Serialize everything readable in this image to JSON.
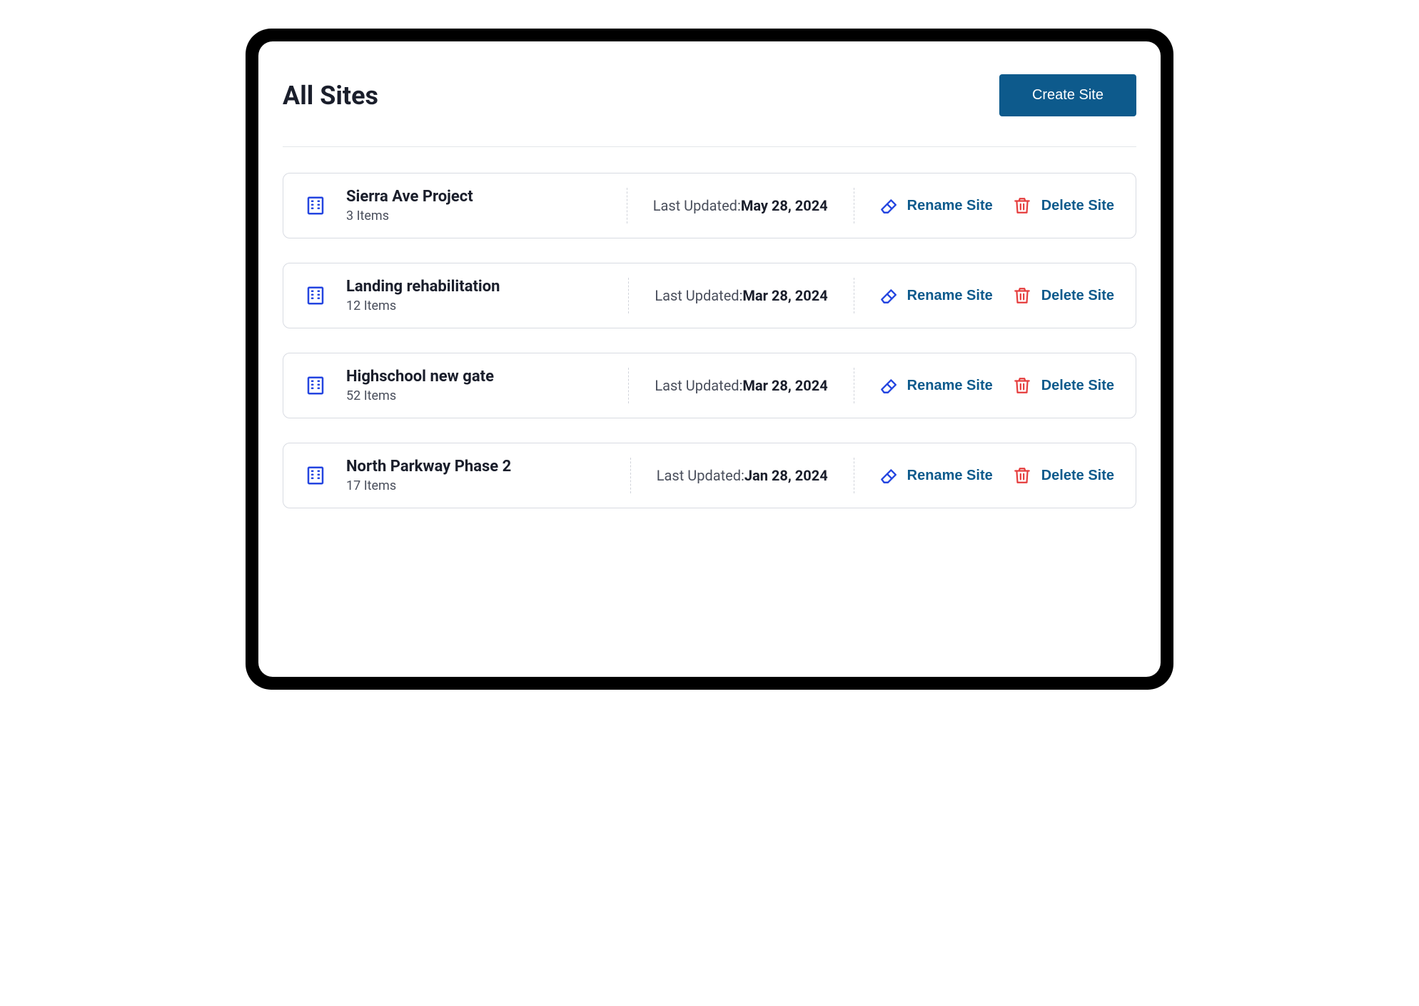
{
  "header": {
    "title": "All Sites",
    "create_label": "Create Site"
  },
  "labels": {
    "last_updated": "Last Updated:",
    "items_suffix": " Items",
    "rename": "Rename Site",
    "delete": "Delete Site"
  },
  "colors": {
    "primary": "#0d5a8c",
    "building_icon": "#2445e0",
    "rename_icon": "#2445e0",
    "delete_icon": "#e53c3c",
    "text_dark": "#1a1e2b",
    "text_muted": "#4a4f5c",
    "border": "#d8dbe2"
  },
  "sites": [
    {
      "name": "Sierra Ave Project",
      "items": "3",
      "updated": "May 28, 2024"
    },
    {
      "name": "Landing rehabilitation",
      "items": "12",
      "updated": "Mar 28, 2024"
    },
    {
      "name": "Highschool new gate",
      "items": "52",
      "updated": "Mar 28, 2024"
    },
    {
      "name": "North Parkway Phase 2",
      "items": "17",
      "updated": "Jan 28, 2024"
    }
  ]
}
